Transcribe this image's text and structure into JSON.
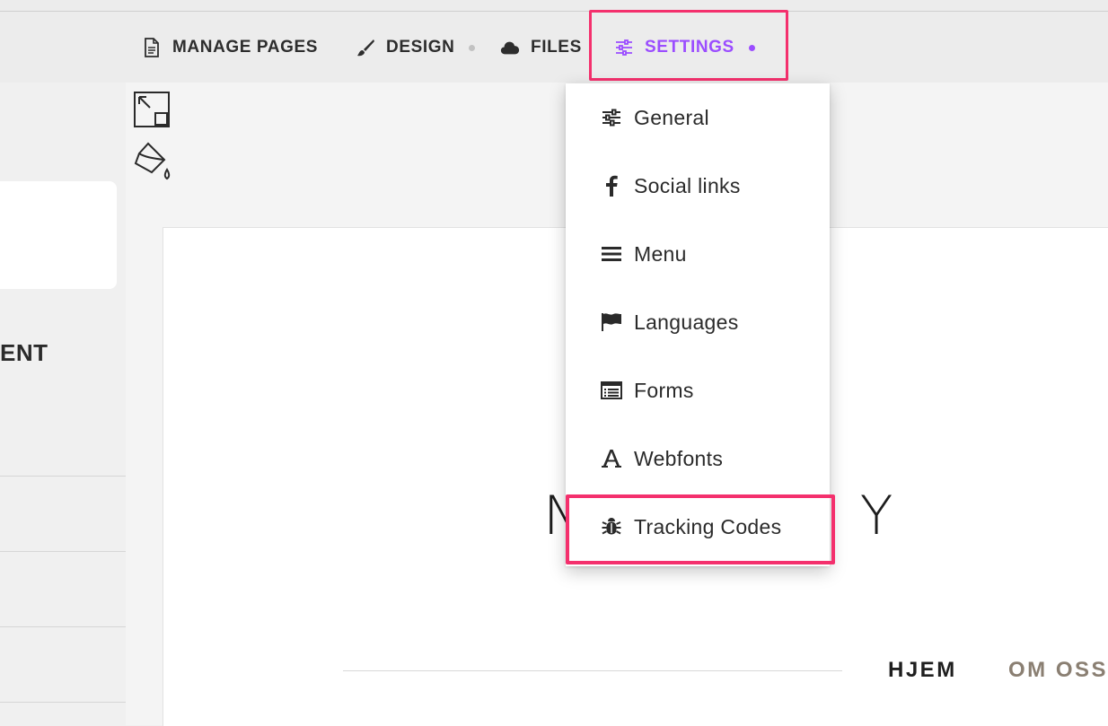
{
  "toolbar": {
    "manage_pages": "MANAGE PAGES",
    "design": "DESIGN",
    "files": "FILES",
    "settings": "SETTINGS"
  },
  "sidebar": {
    "section_title": "ENT"
  },
  "settings_menu": {
    "items": [
      {
        "label": "General",
        "icon": "sliders-icon"
      },
      {
        "label": "Social links",
        "icon": "facebook-icon"
      },
      {
        "label": "Menu",
        "icon": "hamburger-icon"
      },
      {
        "label": "Languages",
        "icon": "flag-icon"
      },
      {
        "label": "Forms",
        "icon": "form-icon"
      },
      {
        "label": "Webfonts",
        "icon": "font-icon"
      },
      {
        "label": "Tracking Codes",
        "icon": "bug-icon"
      }
    ]
  },
  "site_preview": {
    "logo_text": "NIDEBY",
    "nav": [
      "HJEM",
      "OM OSS"
    ]
  },
  "colors": {
    "accent": "#9b4dff",
    "highlight": "#f4306d"
  }
}
